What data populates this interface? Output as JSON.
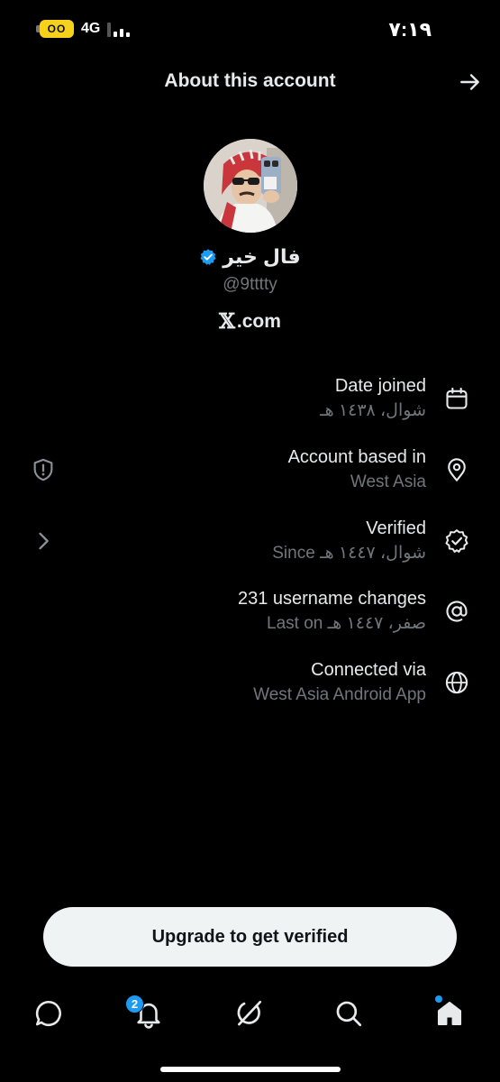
{
  "status_bar": {
    "battery_label": "OO",
    "network": "4G",
    "time": "٧:١٩"
  },
  "header": {
    "title": "About this account",
    "forward_icon": "arrow-right-icon"
  },
  "profile": {
    "display_name": "فال خير",
    "verified_badge_color": "#1d9bf0",
    "handle": "@9tttty",
    "website_prefix": "𝕏",
    "website_suffix": ".com"
  },
  "info_rows": [
    {
      "label": "Date joined",
      "value": "شوال، ١٤٣٨ هـ",
      "icon": "calendar-icon"
    },
    {
      "label": "Account based in",
      "value": "West Asia",
      "icon": "location-pin-icon"
    },
    {
      "label": "Verified",
      "value": "Since شوال، ١٤٤٧ هـ",
      "icon": "verified-badge-icon"
    },
    {
      "label": "231 username changes",
      "value": "Last on صفر، ١٤٤٧ هـ",
      "icon": "at-sign-icon"
    },
    {
      "label": "Connected via",
      "value": "West Asia Android App",
      "icon": "globe-icon"
    }
  ],
  "side_icons": {
    "shield": "shield-alert-icon",
    "chevron": "chevron-right-icon"
  },
  "upgrade_button": {
    "label": "Upgrade to get verified"
  },
  "bottom_nav": {
    "items": [
      "messages-icon",
      "notifications-icon",
      "grok-icon",
      "search-icon",
      "home-icon"
    ],
    "notification_count": "2"
  },
  "colors": {
    "background": "#000000",
    "accent": "#1d9bf0",
    "primary_text": "#e7e9ea",
    "secondary_text": "#71767b"
  }
}
